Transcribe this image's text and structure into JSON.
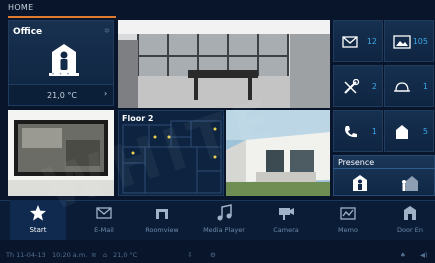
{
  "header": {
    "title": "HOME"
  },
  "office": {
    "label": "Office",
    "temperature": "21,0 °C",
    "chevron": "›",
    "pager": "• • •"
  },
  "floor": {
    "label": "Floor 2"
  },
  "counters": [
    {
      "icon": "email-icon",
      "count": "12"
    },
    {
      "icon": "image-icon",
      "count": "105"
    },
    {
      "icon": "tools-icon",
      "count": "2"
    },
    {
      "icon": "alarm-icon",
      "count": "1"
    },
    {
      "icon": "phone-icon",
      "count": "1"
    },
    {
      "icon": "house-icon",
      "count": "5"
    }
  ],
  "presence": {
    "label": "Presence"
  },
  "dock": [
    {
      "label": "Start",
      "icon": "star-icon",
      "active": true
    },
    {
      "label": "E-Mail",
      "icon": "email-icon"
    },
    {
      "label": "Roomview",
      "icon": "room-icon"
    },
    {
      "label": "Media Player",
      "icon": "music-icon"
    },
    {
      "label": "Camera",
      "icon": "camera-icon"
    },
    {
      "label": "Memo",
      "icon": "memo-icon"
    },
    {
      "label": "Door En",
      "icon": "door-icon"
    }
  ],
  "status": {
    "date": "Th 11-04-13",
    "time": "10:20 a.m.",
    "temp": "21,0 °C"
  },
  "watermark": "WHITE",
  "colors": {
    "accent": "#e07a2f",
    "count": "#3aa7ea",
    "background": "#08152b"
  }
}
